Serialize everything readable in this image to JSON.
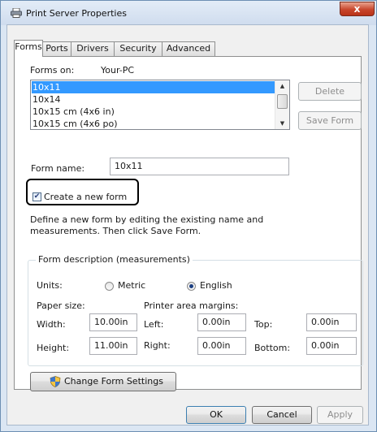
{
  "window": {
    "title": "Print Server Properties",
    "close_glyph": "x"
  },
  "tabs": [
    {
      "label": "Forms",
      "active": true
    },
    {
      "label": "Ports",
      "active": false
    },
    {
      "label": "Drivers",
      "active": false
    },
    {
      "label": "Security",
      "active": false
    },
    {
      "label": "Advanced",
      "active": false
    }
  ],
  "forms_on": {
    "label": "Forms on:",
    "value": "Your-PC"
  },
  "forms_list": {
    "items": [
      "10x11",
      "10x14",
      "10x15 cm (4x6 in)",
      "10x15 cm (4x6 po)"
    ],
    "selected_index": 0
  },
  "buttons": {
    "delete": "Delete",
    "save_form": "Save Form",
    "change_settings": "Change Form Settings",
    "ok": "OK",
    "cancel": "Cancel",
    "apply": "Apply"
  },
  "form_name": {
    "label": "Form name:",
    "value": "10x11"
  },
  "create_new_form": {
    "label": "Create a new form",
    "checked": true
  },
  "description": "Define a new form by editing the existing name and measurements. Then click Save Form.",
  "description_lines": [
    "Define a new form by editing the existing name and",
    "measurements. Then click Save Form."
  ],
  "measurements": {
    "group_title": "Form description (measurements)",
    "units_label": "Units:",
    "metric_label": "Metric",
    "english_label": "English",
    "selected_unit": "English",
    "paper_size_label": "Paper size:",
    "margins_label": "Printer area margins:",
    "width_label": "Width:",
    "width_value": "10.00in",
    "height_label": "Height:",
    "height_value": "11.00in",
    "left_label": "Left:",
    "left_value": "0.00in",
    "right_label": "Right:",
    "right_value": "0.00in",
    "top_label": "Top:",
    "top_value": "0.00in",
    "bottom_label": "Bottom:",
    "bottom_value": "0.00in"
  },
  "icons": {
    "title": "printer-icon",
    "change_settings": "uac-shield-icon"
  },
  "colors": {
    "selection": "#3399ff",
    "close_button": "#c8462c",
    "title_bar": "#dbe6f3"
  }
}
